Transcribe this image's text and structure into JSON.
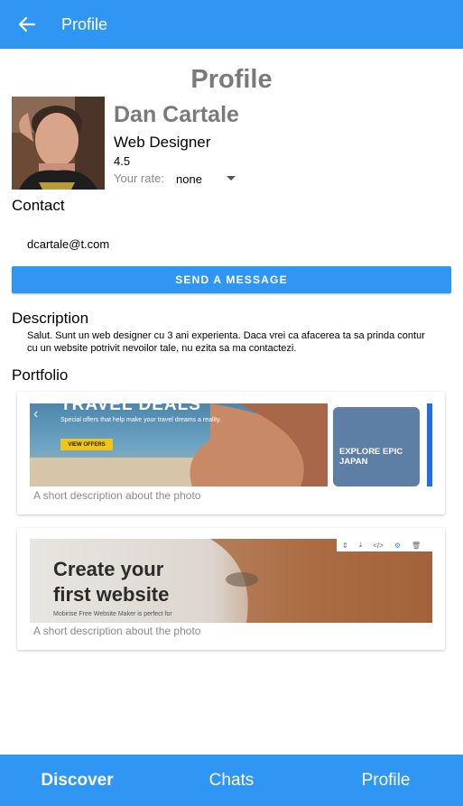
{
  "colors": {
    "primary": "#2f96f3",
    "muted": "#7a7a7a"
  },
  "appbar": {
    "back_icon": "arrow-left-icon",
    "title": "Profile"
  },
  "header": {
    "title": "Profile"
  },
  "profile": {
    "name": "Dan Cartale",
    "role": "Web Designer",
    "rating": "4.5",
    "rate_label": "Your rate:",
    "rate_value": "none"
  },
  "contact": {
    "label": "Contact",
    "email": "dcartale@t.com",
    "send_button": "SEND A MESSAGE"
  },
  "description": {
    "label": "Description",
    "text": "Salut. Sunt un web designer cu 3 ani experienta. Daca vrei ca afacerea ta sa prinda contur cu un website potrivit nevoilor tale, nu ezita sa ma contactezi."
  },
  "portfolio": {
    "label": "Portfolio",
    "items": [
      {
        "caption": "A short description about the photo",
        "img_title": "TRAVEL DEALS",
        "img_sub": "Special offers that help make your travel dreams a reality.",
        "img_button": "VIEW OFFERS",
        "img_phone_title": "EXPLORE EPIC JAPAN"
      },
      {
        "caption": "A short description about the photo",
        "img_title_1": "Create your",
        "img_title_2": "first website",
        "img_sub": "Mobirise Free Website Maker is perfect for"
      }
    ]
  },
  "bottom_nav": {
    "tabs": [
      "Discover",
      "Chats",
      "Profile"
    ],
    "active": "Discover"
  }
}
